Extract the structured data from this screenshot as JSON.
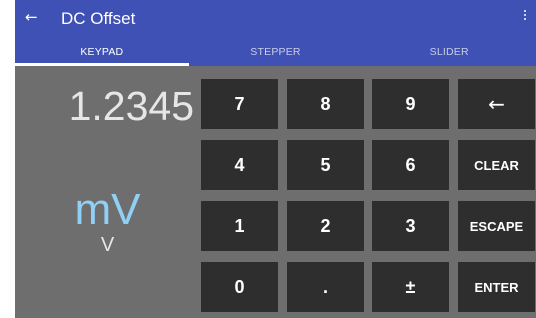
{
  "header": {
    "back_icon": "arrow-left-icon",
    "back_glyph": "←",
    "title": "DC Offset",
    "menu_icon": "more-vert-icon"
  },
  "tabs": [
    {
      "label": "KEYPAD",
      "active": true
    },
    {
      "label": "STEPPER",
      "active": false
    },
    {
      "label": "SLIDER",
      "active": false
    }
  ],
  "display": {
    "value": "1.2345",
    "unit_primary": "mV",
    "unit_secondary": "V"
  },
  "keypad": {
    "k7": "7",
    "k8": "8",
    "k9": "9",
    "backspace": "←",
    "k4": "4",
    "k5": "5",
    "k6": "6",
    "clear": "CLEAR",
    "k1": "1",
    "k2": "2",
    "k3": "3",
    "escape": "ESCAPE",
    "k0": "0",
    "dot": ".",
    "plusminus": "±",
    "enter": "ENTER"
  },
  "colors": {
    "appbar": "#3f51b5",
    "background": "#6e6e6e",
    "key": "#2e2e2e",
    "unit_accent": "#8fd0f4"
  }
}
